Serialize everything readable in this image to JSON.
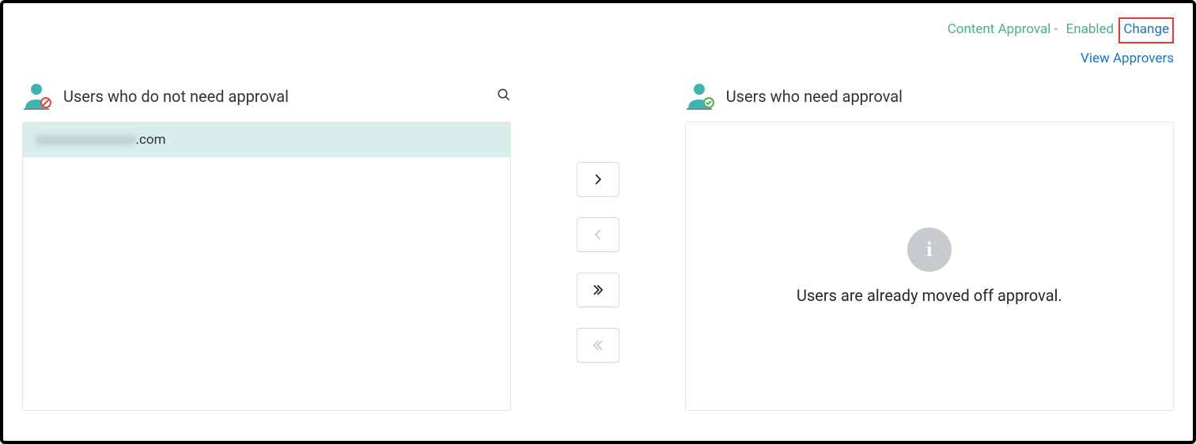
{
  "header": {
    "status_prefix": "Content Approval -",
    "status_value": "Enabled",
    "change_label": "Change",
    "view_approvers_label": "View Approvers"
  },
  "left_panel": {
    "title": "Users who do not need approval",
    "users": [
      {
        "masked": "xxxxxxxxxxxxxxx",
        "suffix": ".com"
      }
    ]
  },
  "right_panel": {
    "title": "Users who need approval",
    "empty_message": "Users are already moved off approval."
  },
  "icons": {
    "user_no_approval": "user-blocked-icon",
    "user_need_approval": "user-check-icon",
    "search": "search-icon",
    "move_right": "chevron-right-icon",
    "move_left": "chevron-left-icon",
    "move_all_right": "double-chevron-right-icon",
    "move_all_left": "double-chevron-left-icon",
    "info": "info-icon"
  }
}
